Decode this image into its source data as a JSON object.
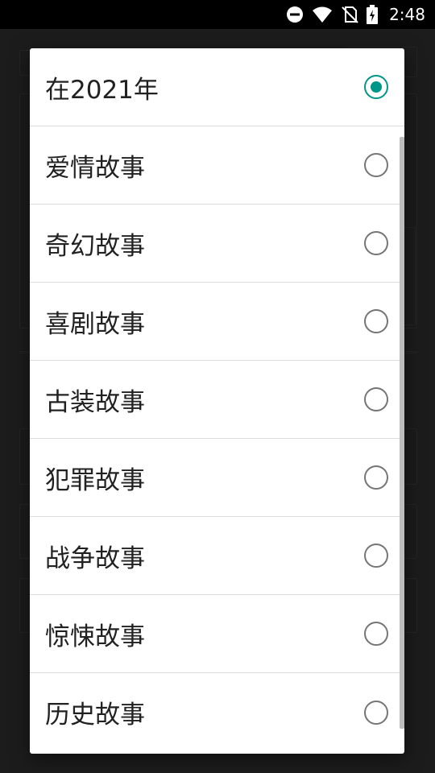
{
  "status_bar": {
    "time": "2:48",
    "icons": [
      "do-not-disturb-icon",
      "wifi-icon",
      "no-sim-icon",
      "battery-charging-icon"
    ]
  },
  "dialog": {
    "options": [
      {
        "label": "在2021年",
        "selected": true
      },
      {
        "label": "爱情故事",
        "selected": false
      },
      {
        "label": "奇幻故事",
        "selected": false
      },
      {
        "label": "喜剧故事",
        "selected": false
      },
      {
        "label": "古装故事",
        "selected": false
      },
      {
        "label": "犯罪故事",
        "selected": false
      },
      {
        "label": "战争故事",
        "selected": false
      },
      {
        "label": "惊悚故事",
        "selected": false
      },
      {
        "label": "历史故事",
        "selected": false
      }
    ]
  },
  "colors": {
    "accent": "#009688",
    "radio_off": "#757575"
  }
}
